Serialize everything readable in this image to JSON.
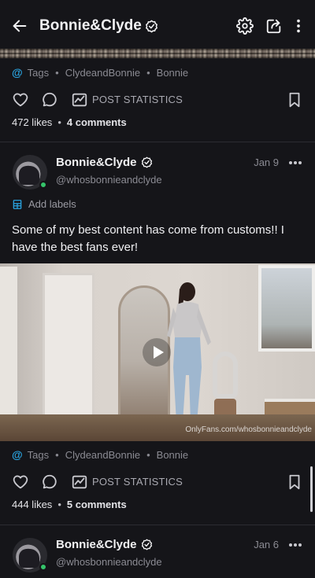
{
  "header": {
    "title": "Bonnie&Clyde",
    "back_icon": "arrow-left-icon",
    "verified_icon": "verified-badge-icon",
    "actions": [
      "gear-icon",
      "share-icon",
      "more-vertical-icon"
    ]
  },
  "post1": {
    "tags_label": "Tags",
    "tags": [
      "ClydeandBonnie",
      "Bonnie"
    ],
    "post_statistics_label": "POST STATISTICS",
    "likes": "472 likes",
    "comments": "4 comments"
  },
  "post2": {
    "author_name": "Bonnie&Clyde",
    "handle": "@whosbonnieandclyde",
    "date": "Jan 9",
    "add_labels": "Add labels",
    "caption": "Some of my best content has come from customs!! I have the best fans ever!",
    "watermark": "OnlyFans.com/whosbonnieandclyde",
    "tags_label": "Tags",
    "tags": [
      "ClydeandBonnie",
      "Bonnie"
    ],
    "post_statistics_label": "POST STATISTICS",
    "likes": "444 likes",
    "comments": "5 comments"
  },
  "post3": {
    "author_name": "Bonnie&Clyde",
    "handle": "@whosbonnieandclyde",
    "date": "Jan 6"
  },
  "colors": {
    "background": "#151519",
    "accent": "#2aa4e0",
    "online": "#35c46a"
  }
}
